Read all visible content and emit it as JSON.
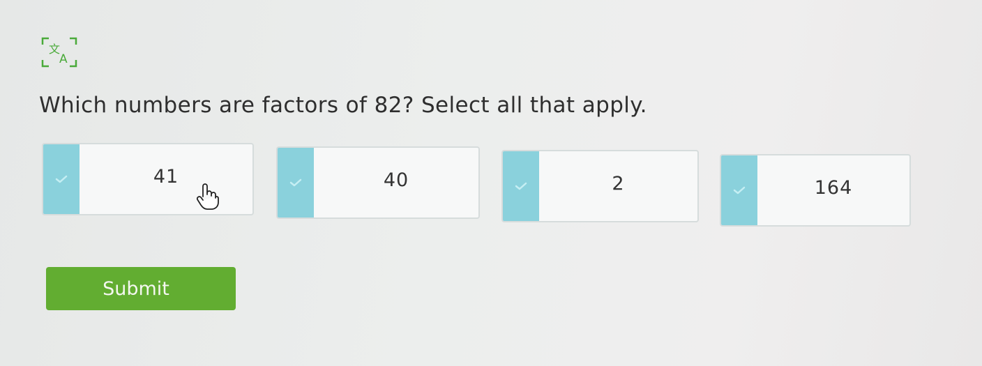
{
  "question": {
    "text": "Which numbers are factors of 82? Select all that apply."
  },
  "toolbar": {
    "translate_icon": "translate-icon"
  },
  "choices": [
    {
      "label": "41",
      "selected": false
    },
    {
      "label": "40",
      "selected": false
    },
    {
      "label": "2",
      "selected": false
    },
    {
      "label": "164",
      "selected": false
    }
  ],
  "submit": {
    "label": "Submit"
  },
  "colors": {
    "check_column": "#8ad1dc",
    "submit_button": "#62ad31",
    "translate_icon": "#4aaa3a"
  }
}
